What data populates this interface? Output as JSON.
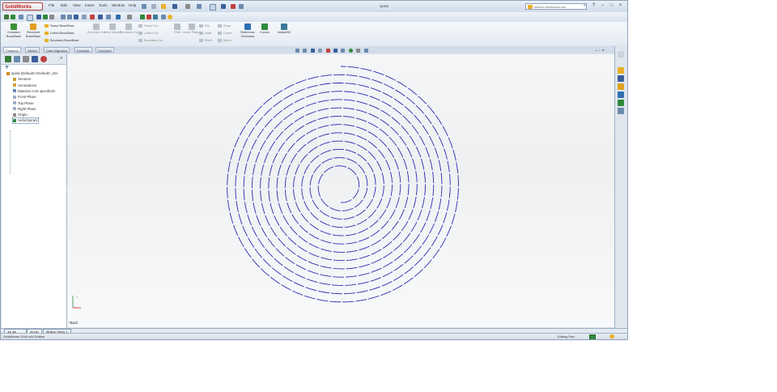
{
  "app": {
    "brand": "SolidWorks",
    "document_title": "spiral",
    "search_placeholder": "search solidworks kno"
  },
  "menu": [
    "File",
    "Edit",
    "View",
    "Insert",
    "Tools",
    "Window",
    "Help"
  ],
  "command_manager": {
    "buttons": [
      {
        "label": "Extruded Boss/Base",
        "enabled": true,
        "color": "#3f8f3a"
      },
      {
        "label": "Revolved Boss/Base",
        "enabled": true,
        "color": "#e0a020"
      },
      {
        "label": "Extruded Cut",
        "enabled": false
      },
      {
        "label": "Hole Wizard",
        "enabled": false
      },
      {
        "label": "Revolved Cut",
        "enabled": false
      },
      {
        "label": "Fillet",
        "enabled": false
      },
      {
        "label": "Linear Pattern",
        "enabled": false
      },
      {
        "label": "Reference Geometry",
        "enabled": true,
        "color": "#2f6fb0"
      },
      {
        "label": "Curves",
        "enabled": true,
        "color": "#2f8a3c"
      },
      {
        "label": "Instant3D",
        "enabled": true,
        "color": "#3a7a9a"
      }
    ],
    "stacked_left": [
      "Swept Boss/Base",
      "Lofted Boss/Base",
      "Boundary Boss/Base"
    ],
    "stacked_mid": [
      "Swept Cut",
      "Lofted Cut",
      "Boundary Cut"
    ],
    "stacked_right_a": [
      "Rib",
      "Draft",
      "Shell"
    ],
    "stacked_right_b": [
      "Wrap",
      "Dome",
      "Mirror"
    ]
  },
  "command_tabs": [
    "Features",
    "Sketch",
    "Data Migration",
    "Evaluate",
    "DimXpert"
  ],
  "feature_tree": [
    {
      "label": "spiral (Default<<Default>_Dis",
      "icon": "part-icon",
      "color": "#d08a20",
      "indent": 0
    },
    {
      "label": "Sensors",
      "icon": "sensors-icon",
      "color": "#c8a030",
      "indent": 1
    },
    {
      "label": "Annotations",
      "icon": "annotations-icon",
      "color": "#d0a040",
      "indent": 1
    },
    {
      "label": "Material <not specified>",
      "icon": "material-icon",
      "color": "#6a8ab0",
      "indent": 1
    },
    {
      "label": "Front Plane",
      "icon": "plane-icon",
      "color": "#9fb0c4",
      "indent": 1
    },
    {
      "label": "Top Plane",
      "icon": "plane-icon",
      "color": "#9fb0c4",
      "indent": 1
    },
    {
      "label": "Right Plane",
      "icon": "plane-icon",
      "color": "#9fb0c4",
      "indent": 1
    },
    {
      "label": "Origin",
      "icon": "origin-icon",
      "color": "#8a8a8a",
      "indent": 1
    },
    {
      "label": "Helix/Spiral1",
      "icon": "helix-icon",
      "color": "#2f8a3c",
      "indent": 1
    }
  ],
  "viewport": {
    "view_label": "*Back",
    "curve_color": "#2a2ab0",
    "spiral": {
      "turns": 12.5,
      "revolution": "clockwise"
    }
  },
  "bottom_tabs": [
    "Model",
    "Motion Study 1"
  ],
  "status": {
    "left": "SolidWorks 2010 x64 Edition",
    "mode": "Editing Part"
  }
}
